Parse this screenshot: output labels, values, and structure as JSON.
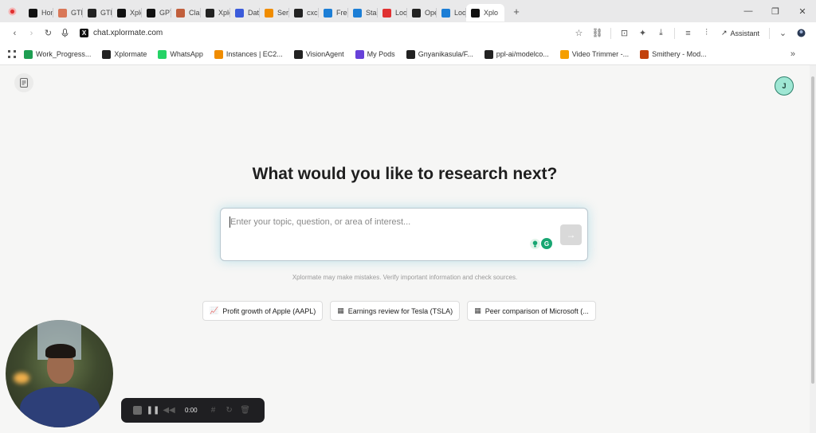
{
  "browser": {
    "tabs": [
      {
        "label": "Hom",
        "icon": "x-logo-icon",
        "color": "#111111"
      },
      {
        "label": "GTM",
        "icon": "claude-sparkle-icon",
        "color": "#d97757"
      },
      {
        "label": "GTM",
        "icon": "openai-icon",
        "color": "#222222"
      },
      {
        "label": "Xplo",
        "icon": "x-logo-icon",
        "color": "#111111"
      },
      {
        "label": "GPT",
        "icon": "gpt-icon",
        "color": "#111111"
      },
      {
        "label": "Clau",
        "icon": "claude-icon",
        "color": "#c15f3c"
      },
      {
        "label": "Xplo",
        "icon": "github-icon",
        "color": "#222222"
      },
      {
        "label": "Data",
        "icon": "data-icon",
        "color": "#3b5bdb"
      },
      {
        "label": "Serv",
        "icon": "aws-icon",
        "color": "#f08c00"
      },
      {
        "label": "cxcs",
        "icon": "github-icon",
        "color": "#222222"
      },
      {
        "label": "Free",
        "icon": "gear-icon",
        "color": "#1c7ed6"
      },
      {
        "label": "Start",
        "icon": "gear-icon",
        "color": "#1c7ed6"
      },
      {
        "label": "Loon",
        "icon": "loom-icon",
        "color": "#e03131"
      },
      {
        "label": "Ope",
        "icon": "openai-icon",
        "color": "#222222"
      },
      {
        "label": "Loon",
        "icon": "gear-icon",
        "color": "#1c7ed6"
      },
      {
        "label": "Xplo",
        "icon": "x-logo-icon",
        "color": "#111111",
        "active": true
      }
    ],
    "url": "chat.xplormate.com",
    "assistant_label": "Assistant",
    "bookmarks": [
      {
        "label": "Work_Progress...",
        "icon": "sheets-icon",
        "color": "#1e9e52"
      },
      {
        "label": "Xplormate",
        "icon": "github-icon",
        "color": "#222222"
      },
      {
        "label": "WhatsApp",
        "icon": "whatsapp-icon",
        "color": "#25d366"
      },
      {
        "label": "Instances | EC2...",
        "icon": "aws-icon",
        "color": "#f08c00"
      },
      {
        "label": "VisionAgent",
        "icon": "visionagent-icon",
        "color": "#222222"
      },
      {
        "label": "My Pods",
        "icon": "pods-icon",
        "color": "#6741d9"
      },
      {
        "label": "Gnyanikasula/F...",
        "icon": "github-icon",
        "color": "#222222"
      },
      {
        "label": "ppl-ai/modelco...",
        "icon": "github-icon",
        "color": "#222222"
      },
      {
        "label": "Video Trimmer -...",
        "icon": "video-trimmer-icon",
        "color": "#f59f00"
      },
      {
        "label": "Smithery - Mod...",
        "icon": "smithery-icon",
        "color": "#c2410c"
      }
    ]
  },
  "app": {
    "avatar_initial": "J",
    "headline": "What would you like to research next?",
    "input_placeholder": "Enter your topic, question, or area of interest...",
    "disclaimer": "Xplormate may make mistakes. Verify important information and check sources.",
    "suggestions": [
      {
        "label": "Profit growth of Apple (AAPL)",
        "icon": "chart-icon"
      },
      {
        "label": "Earnings review for Tesla (TSLA)",
        "icon": "table-icon"
      },
      {
        "label": "Peer comparison of Microsoft (...",
        "icon": "table-icon"
      }
    ]
  },
  "recorder": {
    "time": "0:00"
  }
}
